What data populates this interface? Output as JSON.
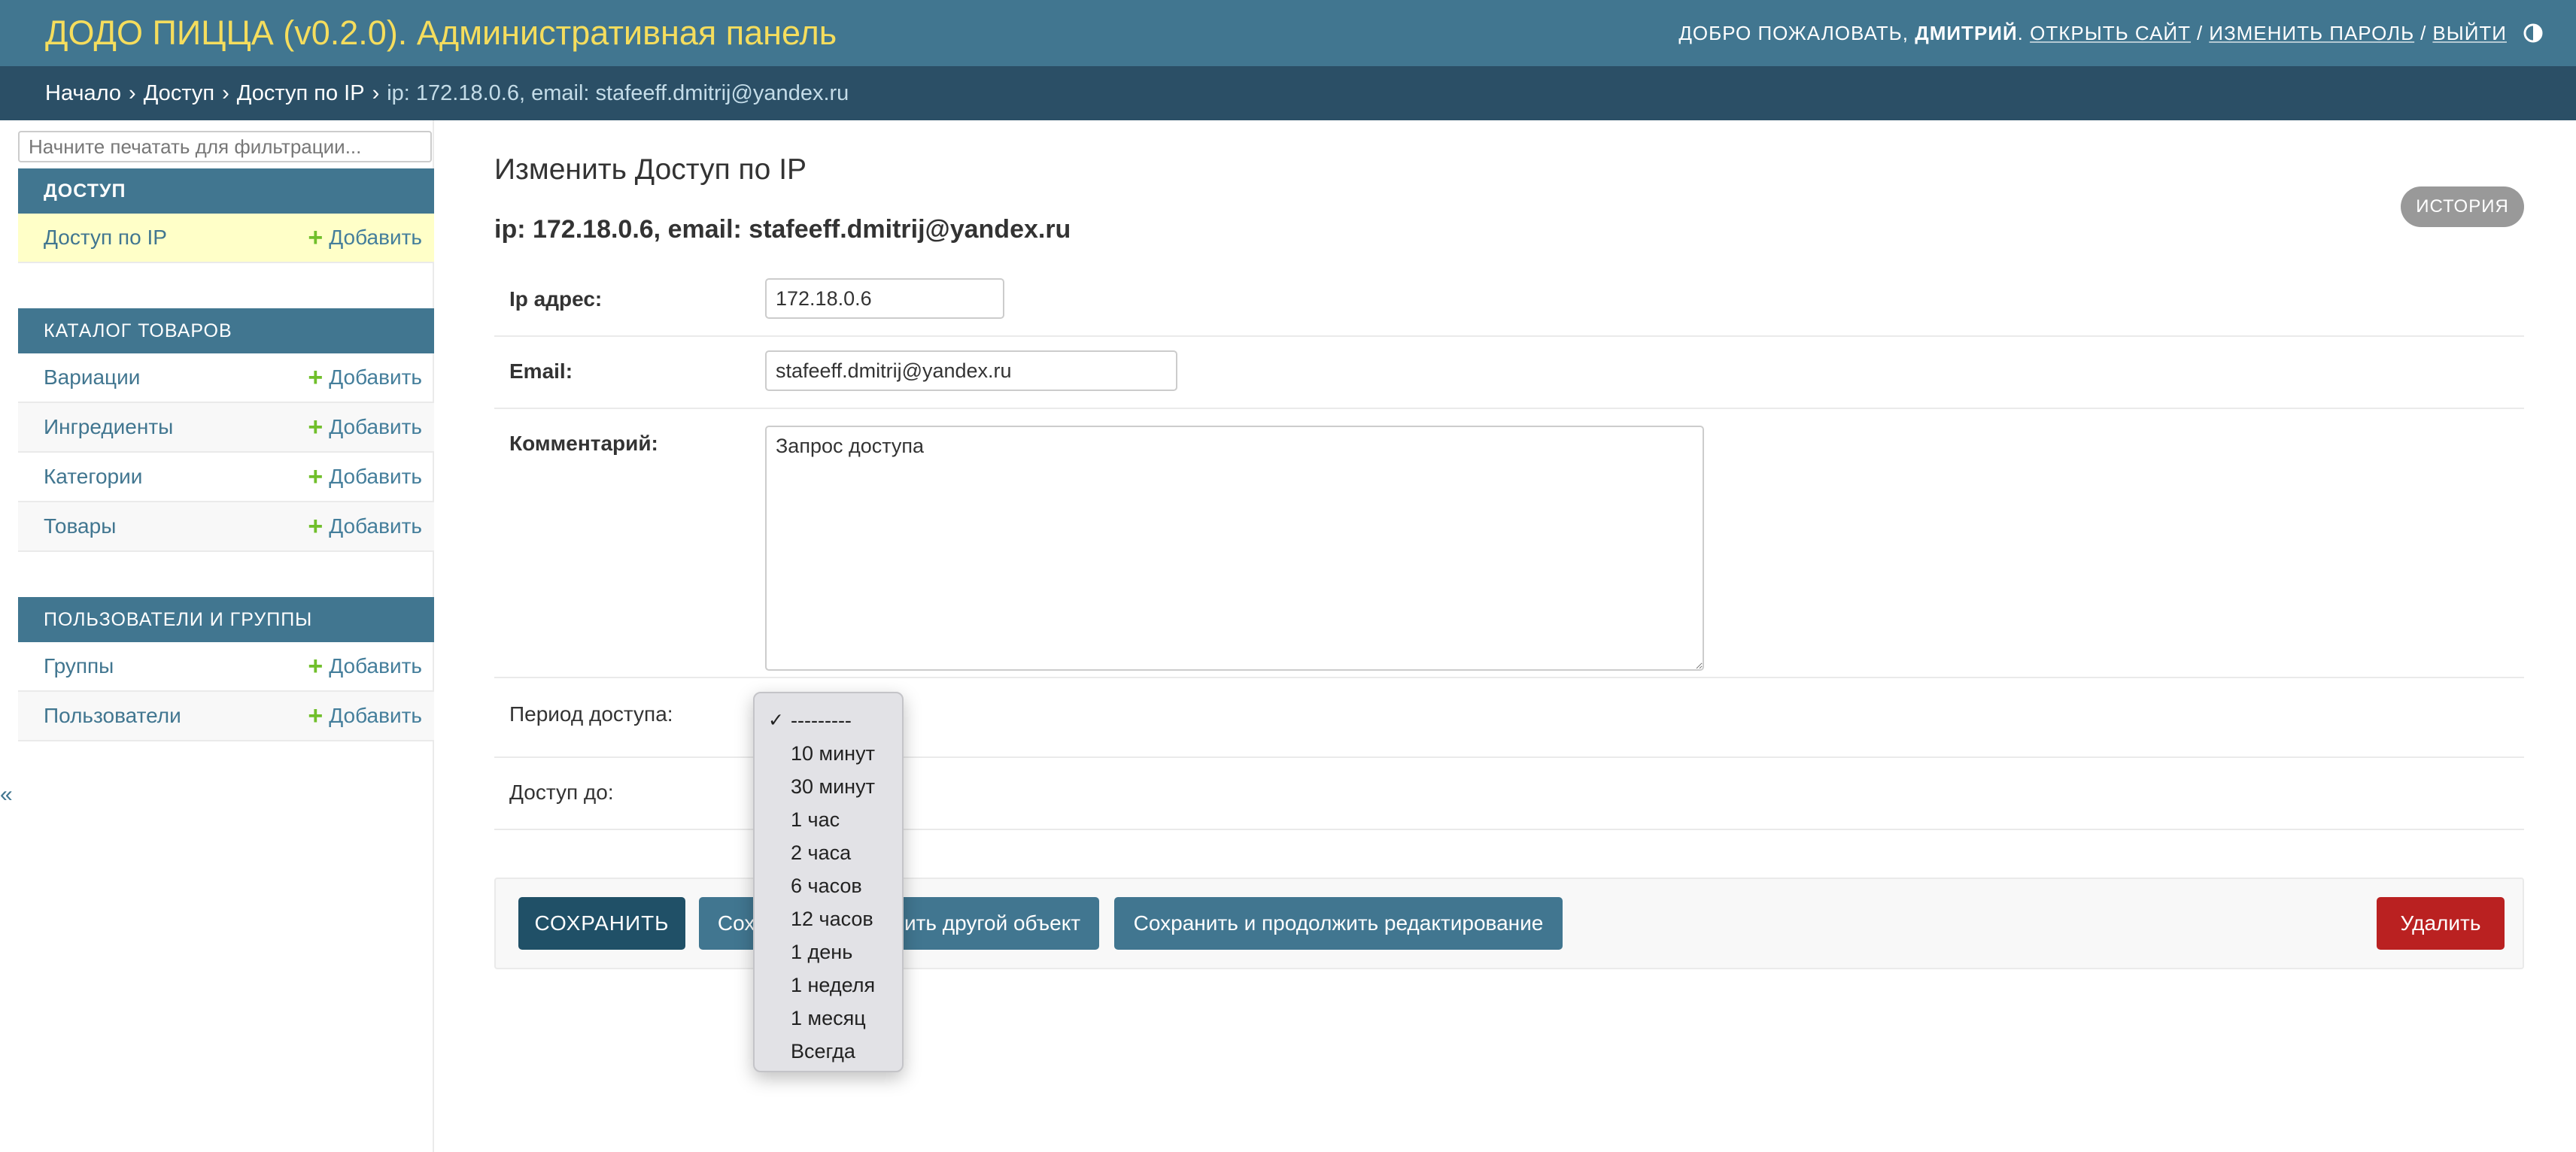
{
  "header": {
    "title": "ДОДО ПИЦЦА (v0.2.0). Административная панель",
    "welcome": "ДОБРО ПОЖАЛОВАТЬ,",
    "username": "ДМИТРИЙ",
    "view_site": "ОТКРЫТЬ САЙТ",
    "change_password": "ИЗМЕНИТЬ ПАРОЛЬ",
    "logout": "ВЫЙТИ",
    "separator": "/"
  },
  "breadcrumbs": {
    "home": "Начало",
    "app": "Доступ",
    "model": "Доступ по IP",
    "current": "ip: 172.18.0.6, email: stafeeff.dmitrij@yandex.ru",
    "arrow": "›"
  },
  "sidebar": {
    "filter_placeholder": "Начните печатать для фильтрации...",
    "add_label": "Добавить",
    "plus": "+",
    "collapse": "«",
    "modules": [
      {
        "caption": "Доступ",
        "items": [
          {
            "label": "Доступ по IP"
          }
        ]
      },
      {
        "caption": "Каталог товаров",
        "items": [
          {
            "label": "Вариации"
          },
          {
            "label": "Ингредиенты"
          },
          {
            "label": "Категории"
          },
          {
            "label": "Товары"
          }
        ]
      },
      {
        "caption": "Пользователи и группы",
        "items": [
          {
            "label": "Группы"
          },
          {
            "label": "Пользователи"
          }
        ]
      }
    ]
  },
  "content": {
    "page_title": "Изменить Доступ по IP",
    "object_title": "ip: 172.18.0.6, email: stafeeff.dmitrij@yandex.ru",
    "history_label": "ИСТОРИЯ",
    "fields": {
      "ip": {
        "label": "Ip адрес:",
        "value": "172.18.0.6"
      },
      "email": {
        "label": "Email:",
        "value": "stafeeff.dmitrij@yandex.ru"
      },
      "comment": {
        "label": "Комментарий:",
        "value": "Запрос доступа"
      },
      "period": {
        "label": "Период доступа:"
      },
      "until": {
        "label": "Доступ до:"
      }
    }
  },
  "dropdown": {
    "check": "✓",
    "selected_index": 0,
    "options": [
      "---------",
      "10 минут",
      "30 минут",
      "1 час",
      "2 часа",
      "6 часов",
      "12 часов",
      "1 день",
      "1 неделя",
      "1 месяц",
      "Всегда"
    ]
  },
  "submit": {
    "save": "СОХРАНИТЬ",
    "save_add": "Сохранить и добавить другой объект",
    "save_continue": "Сохранить и продолжить редактирование",
    "delete": "Удалить"
  },
  "colors": {
    "header_bg": "#417690",
    "title_yellow": "#f5dd5d",
    "breadcrumbs_bg": "#2b4f66",
    "delete_red": "#ba2121",
    "add_green": "#70bf2b"
  }
}
